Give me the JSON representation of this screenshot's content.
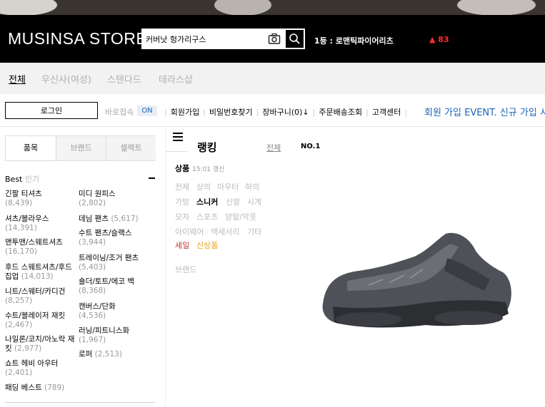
{
  "header": {
    "logo": "MUSINSA STORE",
    "search_value": "커버낫 헝가리구스",
    "trending": "1등 : 로맨틱파이어리츠",
    "trending_change": "▲ 83"
  },
  "subnav": [
    "전체",
    "우신사(여성)",
    "스탠다드",
    "테라스샵"
  ],
  "loginbar": {
    "login_label": "로그인",
    "quick_label": "바로접속",
    "quick_state": "ON",
    "links": [
      "회원가입",
      "비밀번호찾기",
      "장바구니(0)↓",
      "주문배송조회",
      "고객센터"
    ],
    "event": "회원 가입 EVENT. 신규 가입 시"
  },
  "sidebar": {
    "tabs": [
      "품목",
      "브랜드",
      "셀렉트"
    ],
    "best_label": "Best",
    "best_sub": "인기",
    "left_items": [
      {
        "name": "긴팔 티셔츠",
        "count": "(8,439)"
      },
      {
        "name": "셔츠/블라우스",
        "count": "(14,391)"
      },
      {
        "name": "맨투맨/스웨트셔츠",
        "count": "(16,170)"
      },
      {
        "name": "후드 스웨트셔츠/후드 집업",
        "count": "(14,013)"
      },
      {
        "name": "니트/스웨터/카디건",
        "count": "(8,257)"
      },
      {
        "name": "수트/블레이저 재킷",
        "count": "(2,467)"
      },
      {
        "name": "나일론/코치/아노락 재킷",
        "count": "(2,977)"
      },
      {
        "name": "쇼트 헤비 아우터",
        "count": "(2,401)"
      },
      {
        "name": "패딩 베스트",
        "count": "(789)"
      }
    ],
    "right_items": [
      {
        "name": "미디 원피스",
        "count": "(2,802)"
      },
      {
        "name": "데님 팬츠",
        "count": "(5,617)"
      },
      {
        "name": "수트 팬츠/슬랙스",
        "count": "(3,944)"
      },
      {
        "name": "트레이닝/조거 팬츠",
        "count": "(5,403)"
      },
      {
        "name": "숄더/토트/에코 백",
        "count": "(8,368)"
      },
      {
        "name": "캔버스/단화",
        "count": "(4,536)"
      },
      {
        "name": "러닝/피트니스화",
        "count": "(1,967)"
      },
      {
        "name": "로퍼",
        "count": "(2,513)"
      }
    ]
  },
  "main": {
    "title": "랭킹",
    "all_link": "전체",
    "no1": "NO.1",
    "product_label": "상품",
    "updated": "15:01 갱신",
    "filters": [
      [
        "전체",
        "상의",
        "아우터",
        "하의"
      ],
      [
        "가방",
        "스니커",
        "신발",
        "시계"
      ],
      [
        "모자",
        "스포츠",
        "양말/악옷"
      ],
      [
        "아이웨어",
        "액세서리",
        "기타"
      ],
      [
        "세일",
        "신상품"
      ]
    ],
    "brand_label": "브랜드"
  }
}
